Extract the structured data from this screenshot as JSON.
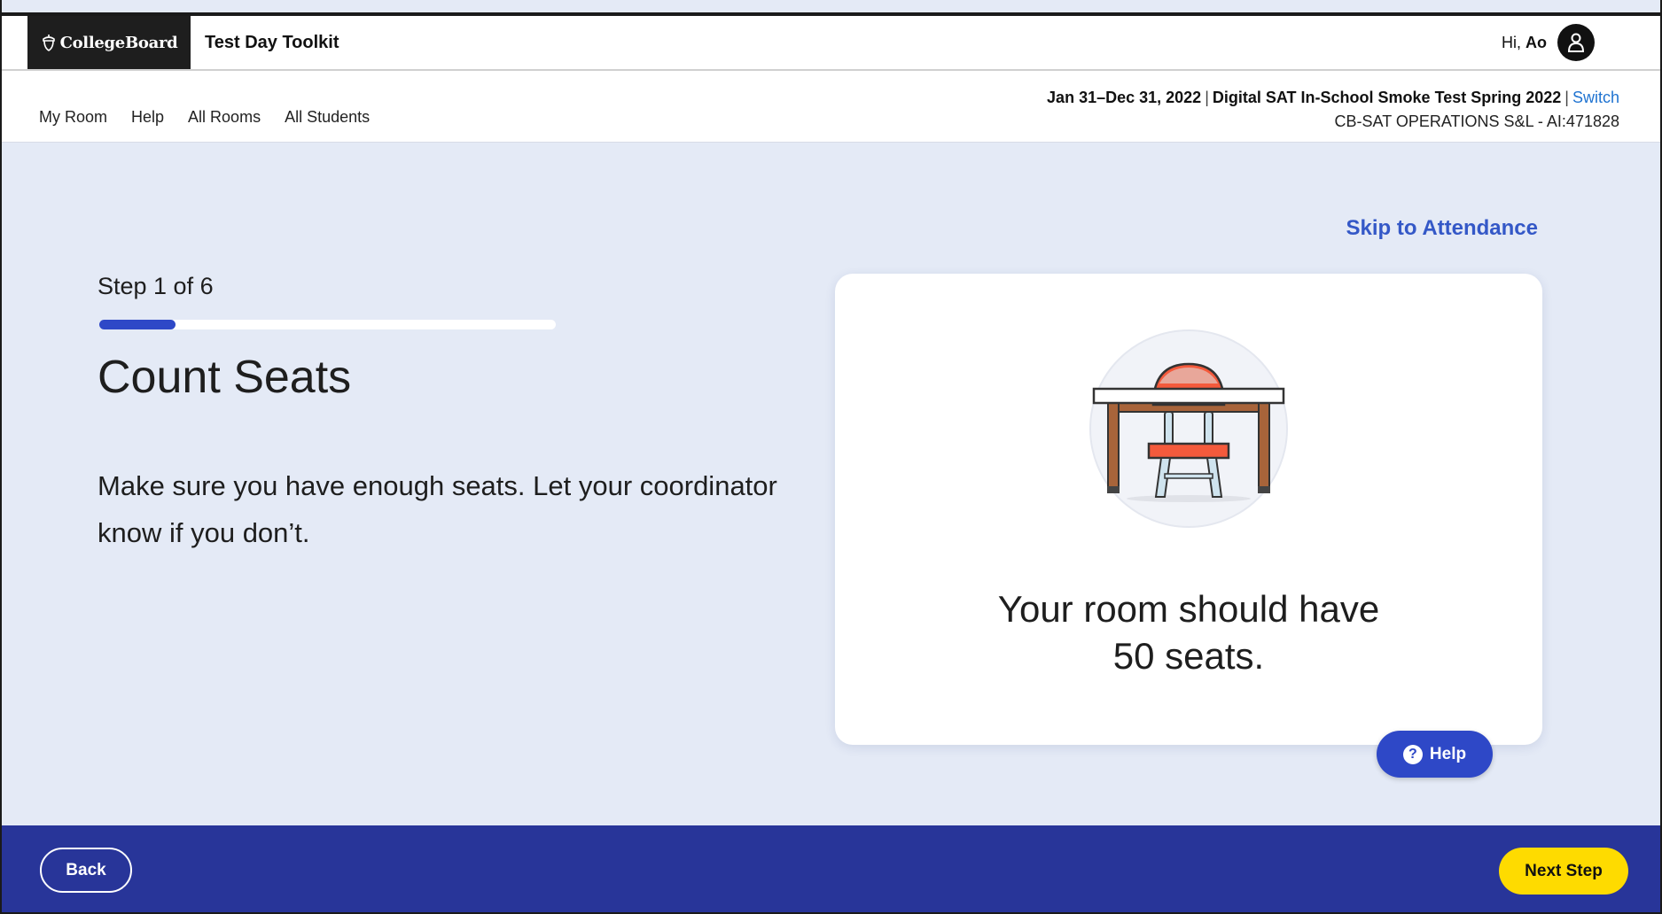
{
  "header": {
    "logo_text": "CollegeBoard",
    "app_title": "Test Day Toolkit",
    "greeting_prefix": "Hi,",
    "user_name": "Ao"
  },
  "nav": {
    "items": [
      {
        "label": "My Room"
      },
      {
        "label": "Help"
      },
      {
        "label": "All Rooms"
      },
      {
        "label": "All Students"
      }
    ]
  },
  "admin": {
    "dates": "Jan 31–Dec 31, 2022",
    "test_name": "Digital SAT In-School Smoke Test Spring 2022",
    "separator": "|",
    "switch_label": "Switch",
    "org": "CB-SAT OPERATIONS S&L - AI:471828"
  },
  "main": {
    "skip_label": "Skip to Attendance",
    "step_label": "Step 1 of 6",
    "progress_fraction": 0.1667,
    "title": "Count Seats",
    "description": "Make sure you have enough seats. Let your coordinator know if you don’t."
  },
  "card": {
    "message_line1": "Your room should have",
    "message_line2": "50 seats."
  },
  "help_button": {
    "label": "Help"
  },
  "footer": {
    "back_label": "Back",
    "next_label": "Next Step"
  },
  "colors": {
    "accent": "#2e48c7",
    "footer": "#283599",
    "next_button": "#fedb00",
    "link": "#1f73d1",
    "background": "#e4eaf6"
  }
}
